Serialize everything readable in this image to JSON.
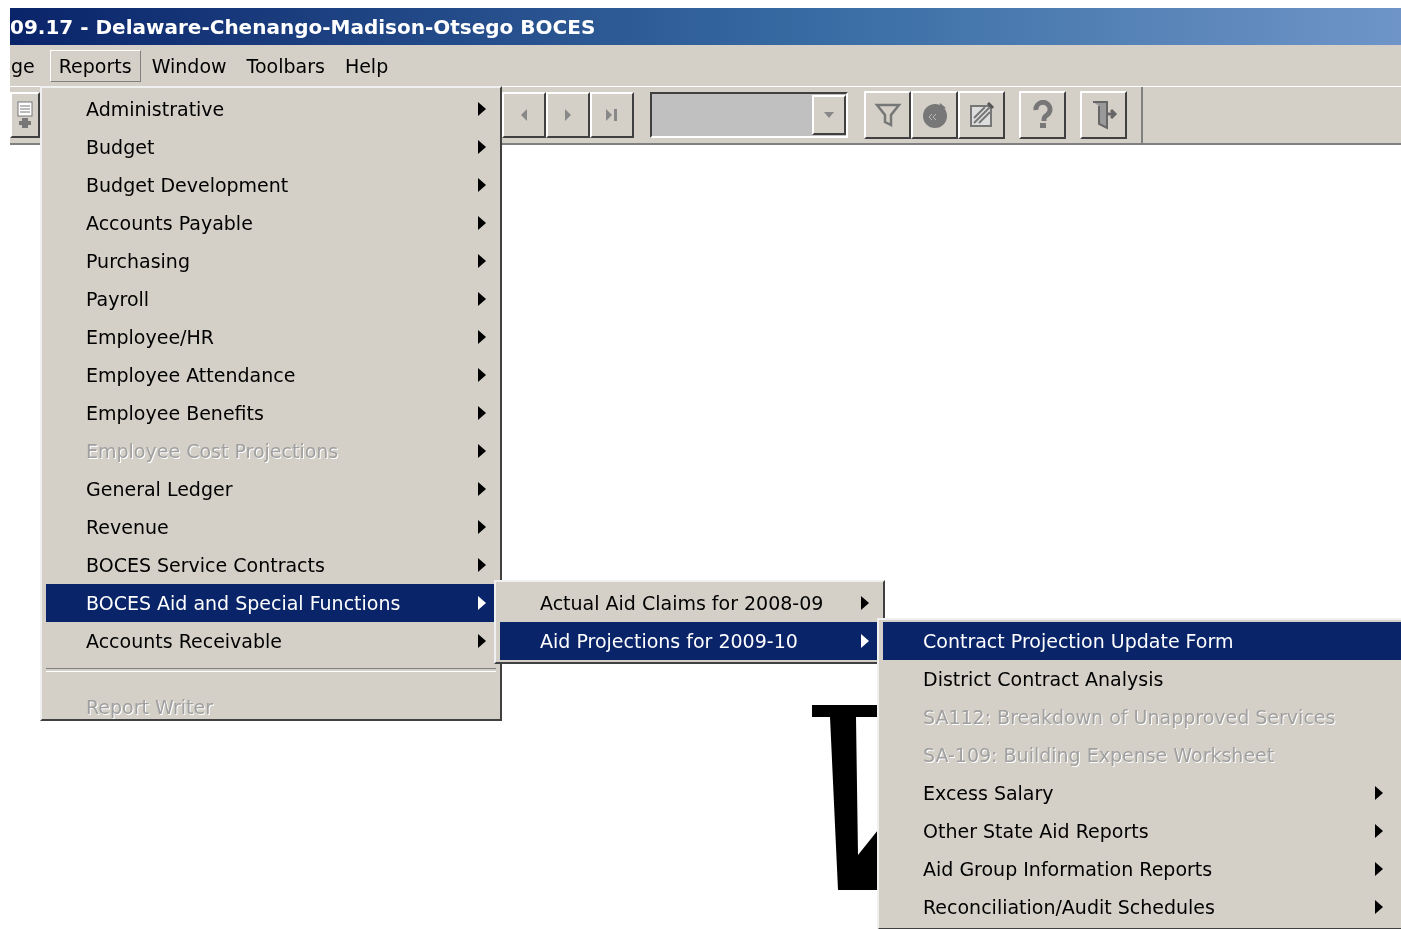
{
  "window": {
    "title": "09.17 - Delaware-Chenango-Madison-Otsego BOCES"
  },
  "menu_bar": [
    {
      "label": "ge",
      "selected": false
    },
    {
      "label": "Reports",
      "selected": true
    },
    {
      "label": "Window",
      "selected": false
    },
    {
      "label": "Toolbars",
      "selected": false
    },
    {
      "label": "Help",
      "selected": false
    }
  ],
  "reports_menu": [
    {
      "kind": "item",
      "label": "Administrative",
      "submenu": true,
      "disabled": false,
      "selected": false
    },
    {
      "kind": "item",
      "label": "Budget",
      "submenu": true,
      "disabled": false,
      "selected": false
    },
    {
      "kind": "item",
      "label": "Budget Development",
      "submenu": true,
      "disabled": false,
      "selected": false
    },
    {
      "kind": "item",
      "label": "Accounts Payable",
      "submenu": true,
      "disabled": false,
      "selected": false
    },
    {
      "kind": "item",
      "label": "Purchasing",
      "submenu": true,
      "disabled": false,
      "selected": false
    },
    {
      "kind": "item",
      "label": "Payroll",
      "submenu": true,
      "disabled": false,
      "selected": false
    },
    {
      "kind": "item",
      "label": "Employee/HR",
      "submenu": true,
      "disabled": false,
      "selected": false
    },
    {
      "kind": "item",
      "label": "Employee Attendance",
      "submenu": true,
      "disabled": false,
      "selected": false
    },
    {
      "kind": "item",
      "label": "Employee Benefits",
      "submenu": true,
      "disabled": false,
      "selected": false
    },
    {
      "kind": "item",
      "label": "Employee Cost Projections",
      "submenu": true,
      "disabled": true,
      "selected": false
    },
    {
      "kind": "item",
      "label": "General Ledger",
      "submenu": true,
      "disabled": false,
      "selected": false
    },
    {
      "kind": "item",
      "label": "Revenue",
      "submenu": true,
      "disabled": false,
      "selected": false
    },
    {
      "kind": "item",
      "label": "BOCES Service Contracts",
      "submenu": true,
      "disabled": false,
      "selected": false
    },
    {
      "kind": "item",
      "label": "BOCES Aid and Special Functions",
      "submenu": true,
      "disabled": false,
      "selected": true
    },
    {
      "kind": "item",
      "label": "Accounts Receivable",
      "submenu": true,
      "disabled": false,
      "selected": false
    },
    {
      "kind": "separator"
    },
    {
      "kind": "item",
      "label": "Report Writer",
      "submenu": false,
      "disabled": true,
      "selected": false
    }
  ],
  "aid_submenu": [
    {
      "kind": "item",
      "label": "Actual Aid Claims for 2008-09",
      "submenu": true,
      "disabled": false,
      "selected": false
    },
    {
      "kind": "item",
      "label": "Aid Projections for 2009-10",
      "submenu": true,
      "disabled": false,
      "selected": true
    }
  ],
  "projections_submenu": [
    {
      "kind": "item",
      "label": "Contract Projection Update Form",
      "submenu": false,
      "disabled": false,
      "selected": true
    },
    {
      "kind": "item",
      "label": "District Contract Analysis",
      "submenu": false,
      "disabled": false,
      "selected": false
    },
    {
      "kind": "item",
      "label": "SA112: Breakdown of Unapproved Services",
      "submenu": false,
      "disabled": true,
      "selected": false
    },
    {
      "kind": "item",
      "label": "SA-109: Building Expense Worksheet",
      "submenu": false,
      "disabled": true,
      "selected": false
    },
    {
      "kind": "item",
      "label": "Excess Salary",
      "submenu": true,
      "disabled": false,
      "selected": false
    },
    {
      "kind": "item",
      "label": "Other State Aid Reports",
      "submenu": true,
      "disabled": false,
      "selected": false
    },
    {
      "kind": "item",
      "label": "Aid Group Information Reports",
      "submenu": true,
      "disabled": false,
      "selected": false
    },
    {
      "kind": "item",
      "label": "Reconciliation/Audit Schedules",
      "submenu": true,
      "disabled": false,
      "selected": false
    }
  ]
}
